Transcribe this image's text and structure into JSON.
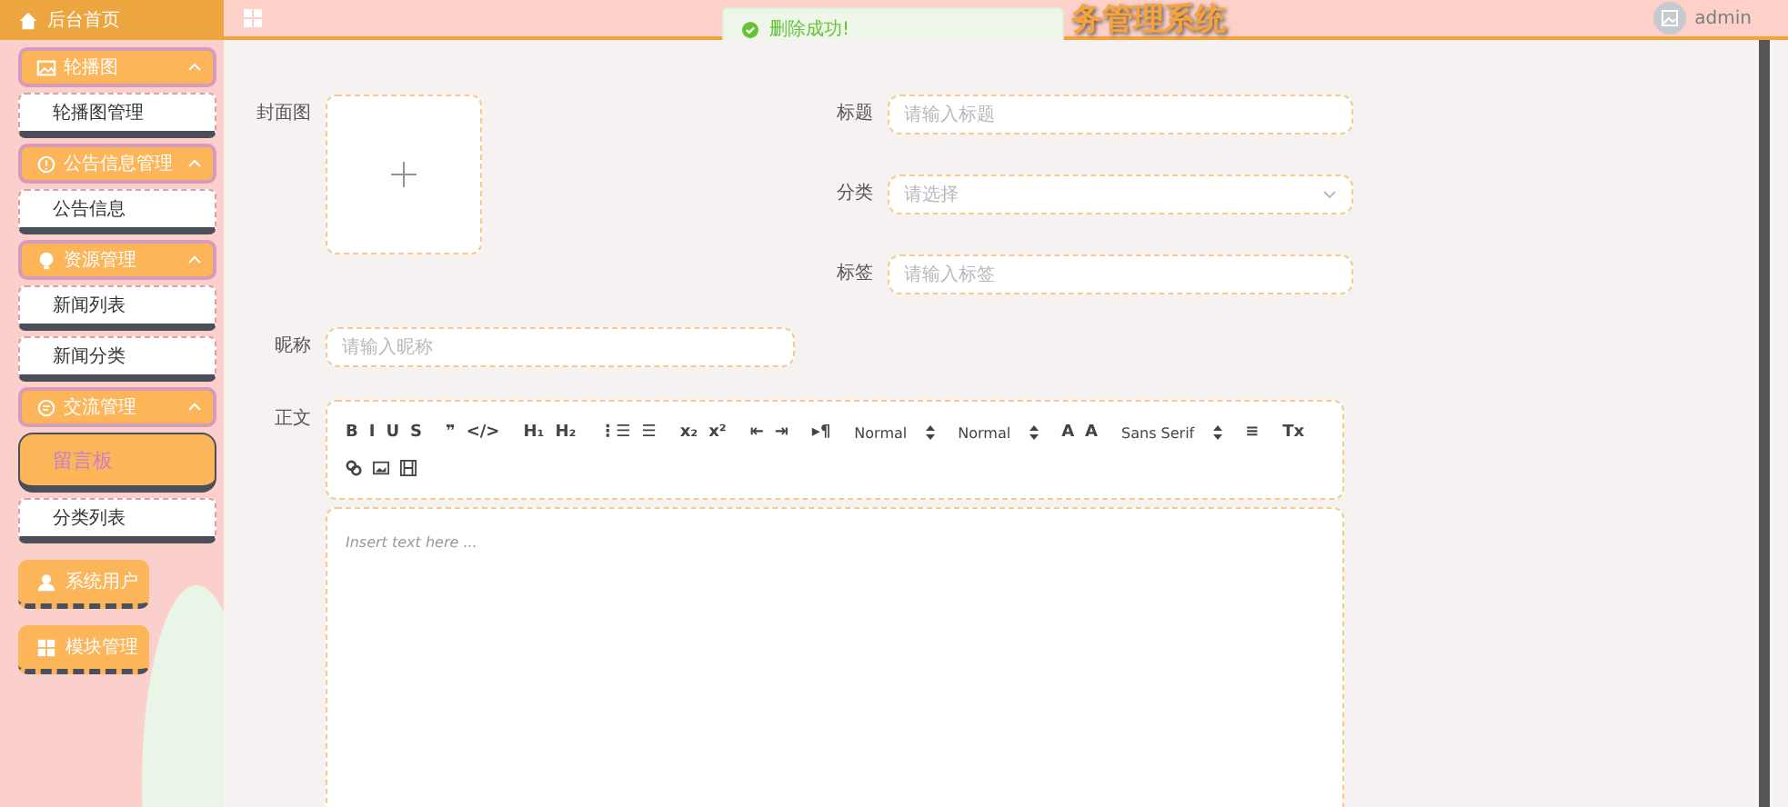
{
  "sidebar": {
    "home": "后台首页",
    "menu": [
      {
        "kind": "group",
        "label": "轮播图",
        "expanded": true,
        "children": [
          {
            "label": "轮播图管理",
            "selected": false
          }
        ]
      },
      {
        "kind": "group",
        "label": "公告信息管理",
        "expanded": true,
        "children": [
          {
            "label": "公告信息",
            "selected": false
          }
        ]
      },
      {
        "kind": "group",
        "label": "资源管理",
        "expanded": true,
        "children": [
          {
            "label": "新闻列表",
            "selected": false
          },
          {
            "label": "新闻分类",
            "selected": false
          }
        ]
      },
      {
        "kind": "group",
        "label": "交流管理",
        "expanded": true,
        "children": [
          {
            "label": "留言板",
            "selected": true
          },
          {
            "label": "分类列表",
            "selected": false
          }
        ]
      },
      {
        "kind": "single",
        "label": "系统用户"
      },
      {
        "kind": "single",
        "label": "模块管理"
      }
    ]
  },
  "header": {
    "title": "务管理系统",
    "user": "admin"
  },
  "toast": {
    "message": "删除成功!"
  },
  "form": {
    "cover_label": "封面图",
    "fields": [
      {
        "label": "标题",
        "placeholder": "请输入标题",
        "kind": "input"
      },
      {
        "label": "分类",
        "placeholder": "请选择",
        "kind": "select"
      },
      {
        "label": "标签",
        "placeholder": "请输入标签",
        "kind": "input"
      }
    ],
    "nickname": {
      "label": "昵称",
      "placeholder": "请输入昵称"
    },
    "body": {
      "label": "正文",
      "placeholder": "Insert text here ...",
      "toolbar": [
        [
          {
            "kind": "button",
            "label": "B"
          },
          {
            "kind": "button",
            "label": "I"
          },
          {
            "kind": "button",
            "label": "U"
          },
          {
            "kind": "button",
            "label": "S"
          }
        ],
        [
          {
            "kind": "button",
            "label": "❞"
          },
          {
            "kind": "button",
            "label": "</>"
          }
        ],
        [
          {
            "kind": "button",
            "label": "H₁"
          },
          {
            "kind": "button",
            "label": "H₂"
          }
        ],
        [
          {
            "kind": "button",
            "label": "⋮☰"
          },
          {
            "kind": "button",
            "label": "☰"
          }
        ],
        [
          {
            "kind": "button",
            "label": "x₂"
          },
          {
            "kind": "button",
            "label": "x²"
          }
        ],
        [
          {
            "kind": "button",
            "label": "⇤"
          },
          {
            "kind": "button",
            "label": "⇥"
          }
        ],
        [
          {
            "kind": "button",
            "label": "▸¶"
          }
        ],
        [
          {
            "kind": "picker",
            "label": "Normal"
          }
        ],
        [
          {
            "kind": "picker",
            "label": "Normal"
          }
        ],
        [
          {
            "kind": "button",
            "label": "A"
          },
          {
            "kind": "button",
            "label": "A"
          }
        ],
        [
          {
            "kind": "picker",
            "label": "Sans Serif"
          }
        ],
        [
          {
            "kind": "button",
            "label": "≡"
          }
        ],
        [
          {
            "kind": "button",
            "label": "Tx"
          }
        ]
      ]
    }
  }
}
